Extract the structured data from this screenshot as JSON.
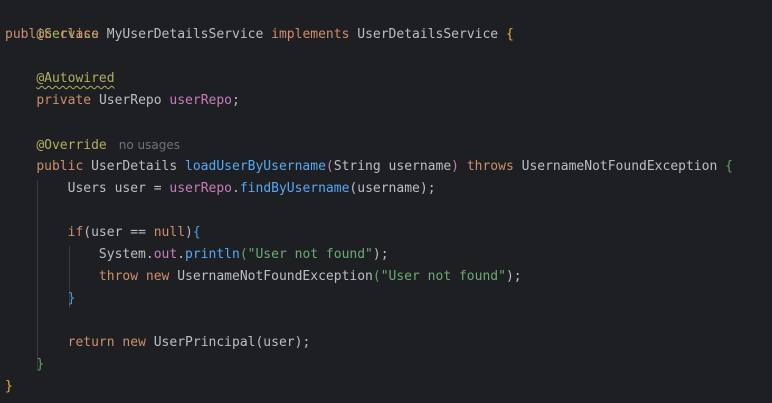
{
  "code": {
    "l1_annotation": "@Service",
    "l2_public": "public",
    "l2_class": "class",
    "l2_classname": "MyUserDetailsService",
    "l2_implements": "implements",
    "l2_interface": "UserDetailsService",
    "l2_brace": "{",
    "l4_annotation": "@Autowired",
    "l5_private": "private",
    "l5_type": "UserRepo",
    "l5_field": "userRepo",
    "l5_semi": ";",
    "l7_annotation": "@Override",
    "l7_hint": "no usages",
    "l8_public": "public",
    "l8_type": "UserDetails",
    "l8_method": "loadUserByUsername",
    "l8_paren_open": "(",
    "l8_param_type": "String",
    "l8_param_name": "username",
    "l8_paren_close": ")",
    "l8_throws": "throws",
    "l8_exception": "UsernameNotFoundException",
    "l8_brace": "{",
    "l9_type": "Users",
    "l9_var": "user",
    "l9_eq": "=",
    "l9_field": "userRepo",
    "l9_dot": ".",
    "l9_call": "findByUsername",
    "l9_args": "(username);",
    "l11_if": "if",
    "l11_cond_open": "(user ==",
    "l11_null": "null",
    "l11_cond_close": ")",
    "l11_brace": "{",
    "l12_system": "System.",
    "l12_out": "out",
    "l12_dot": ".",
    "l12_println": "println",
    "l12_open": "(",
    "l12_string": "\"User not found\"",
    "l12_close": ");",
    "l13_throw": "throw",
    "l13_new": "new",
    "l13_exception": "UsernameNotFoundException",
    "l13_open": "(",
    "l13_string": "\"User not found\"",
    "l13_close": ");",
    "l14_brace": "}",
    "l16_return": "return",
    "l16_new": "new",
    "l16_class": "UserPrincipal",
    "l16_args": "(user);",
    "l17_brace": "}",
    "l18_brace": "}"
  },
  "colors": {
    "background": "#1e1f22",
    "keyword": "#cf8e6d",
    "annotation": "#b3ae60",
    "method": "#56a8f5",
    "field": "#c77dbb",
    "string": "#6aab73",
    "text": "#bcbec4"
  }
}
